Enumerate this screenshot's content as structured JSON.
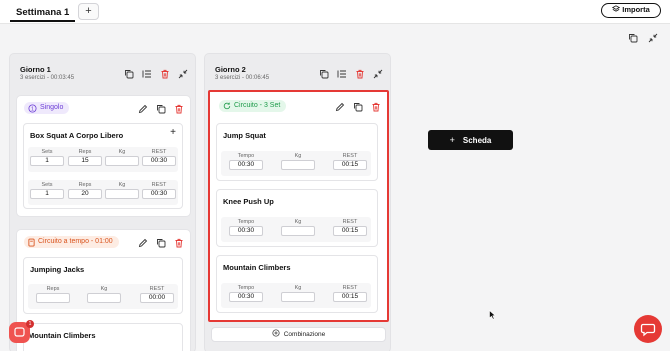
{
  "header": {
    "active_tab": "Settimana 1",
    "add_tab_label": "+",
    "import_label": "Importa"
  },
  "days": [
    {
      "title": "Giorno 1",
      "subtitle": "3 esercizi - 00:03:45",
      "blocks": [
        {
          "type_label": "Singolo",
          "exercise": {
            "title": "Box Squat A Corpo Libero",
            "add_label": "+",
            "columns": [
              "Sets",
              "Reps",
              "Kg",
              "REST"
            ],
            "rows": [
              [
                "1",
                "15",
                "",
                "00:30"
              ],
              [
                "1",
                "20",
                "",
                "00:30"
              ]
            ]
          }
        },
        {
          "type_label": "Circuito a tempo - 01:00",
          "exercise": {
            "title": "Jumping Jacks",
            "columns": [
              "Reps",
              "Kg",
              "REST"
            ],
            "row": [
              "",
              "",
              "00:00"
            ]
          },
          "next_exercise_title": "Mountain Climbers"
        }
      ]
    },
    {
      "title": "Giorno 2",
      "subtitle": "3 esercizi - 00:06:45",
      "blocks": [
        {
          "type_label": "Circuito - 3 Set",
          "exercises": [
            {
              "title": "Jump Squat",
              "columns": [
                "Tempo",
                "Kg",
                "REST"
              ],
              "row": [
                "00:30",
                "",
                "00:15"
              ]
            },
            {
              "title": "Knee Push Up",
              "columns": [
                "Tempo",
                "Kg",
                "REST"
              ],
              "row": [
                "00:30",
                "",
                "00:15"
              ]
            },
            {
              "title": "Mountain Climbers",
              "columns": [
                "Tempo",
                "Kg",
                "REST"
              ],
              "row": [
                "00:30",
                "",
                "00:15"
              ]
            }
          ]
        }
      ],
      "combine_label": "Combinazione"
    }
  ],
  "add_sheet_button": {
    "plus": "+",
    "label": "Scheda"
  },
  "notifications": {
    "count": "1"
  },
  "icons": [
    "copy-icon",
    "reorder-icon",
    "trash-icon",
    "collapse-icon",
    "edit-icon",
    "layers-icon",
    "chat-icon",
    "plus-circle-icon",
    "timer-icon",
    "refresh-icon"
  ],
  "colors": {
    "accent_red": "#e53935",
    "purple": "#6d3fd6",
    "orange": "#d9541e",
    "green": "#1e9b4a",
    "dark": "#111111"
  }
}
